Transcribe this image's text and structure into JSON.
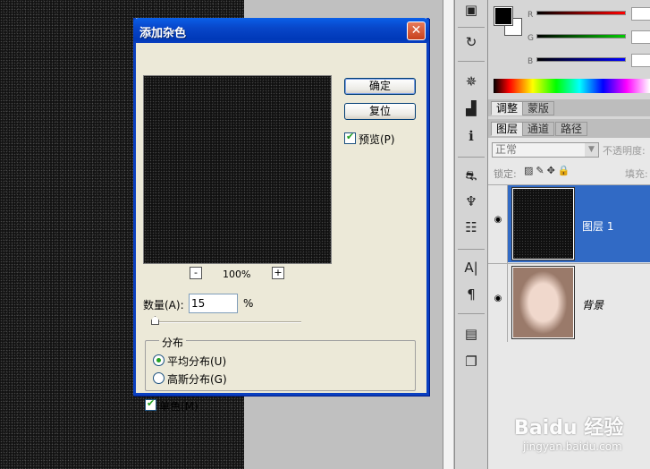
{
  "dialog": {
    "title": "添加杂色",
    "close_glyph": "✕",
    "ok_label": "确定",
    "reset_label": "复位",
    "preview_label": "预览(P)",
    "preview_checked": true,
    "zoom_out": "-",
    "zoom_in": "+",
    "zoom_level": "100%",
    "amount_label": "数量(A):",
    "amount_value": "15",
    "percent_symbol": "%",
    "amount_slider_fraction": 0.09,
    "distribution_legend": "分布",
    "uniform_label": "平均分布(U)",
    "gaussian_label": "高斯分布(G)",
    "selected_distribution": "uniform",
    "monochrome_label": "单色(M)",
    "monochrome_checked": true
  },
  "color_panel": {
    "channels": [
      {
        "label": "R",
        "color": "#ff0000"
      },
      {
        "label": "G",
        "color": "#00aa00"
      },
      {
        "label": "B",
        "color": "#0000ff"
      }
    ],
    "foreground_color": "#000000",
    "background_color": "#ffffff"
  },
  "tabs_top": [
    "调整",
    "蒙版"
  ],
  "tabs_layers": [
    "图层",
    "通道",
    "路径"
  ],
  "layers_panel": {
    "blend_mode": "正常",
    "opacity_label": "不透明度:",
    "lock_label": "锁定:",
    "fill_label": "填充:",
    "layers": [
      {
        "name": "图层 1",
        "selected": true
      },
      {
        "name": "背景",
        "selected": false
      }
    ]
  },
  "tools": [
    "swatch-icon",
    "history-icon",
    "navigator-icon",
    "histogram-icon",
    "info-icon",
    "brushes-icon",
    "clone-source-icon",
    "tool-presets-icon",
    "character-icon",
    "paragraph-icon",
    "notes-icon",
    "layer-comps-icon"
  ],
  "watermark": {
    "text": "Baidu 经验",
    "url": "jingyan.baidu.com"
  }
}
